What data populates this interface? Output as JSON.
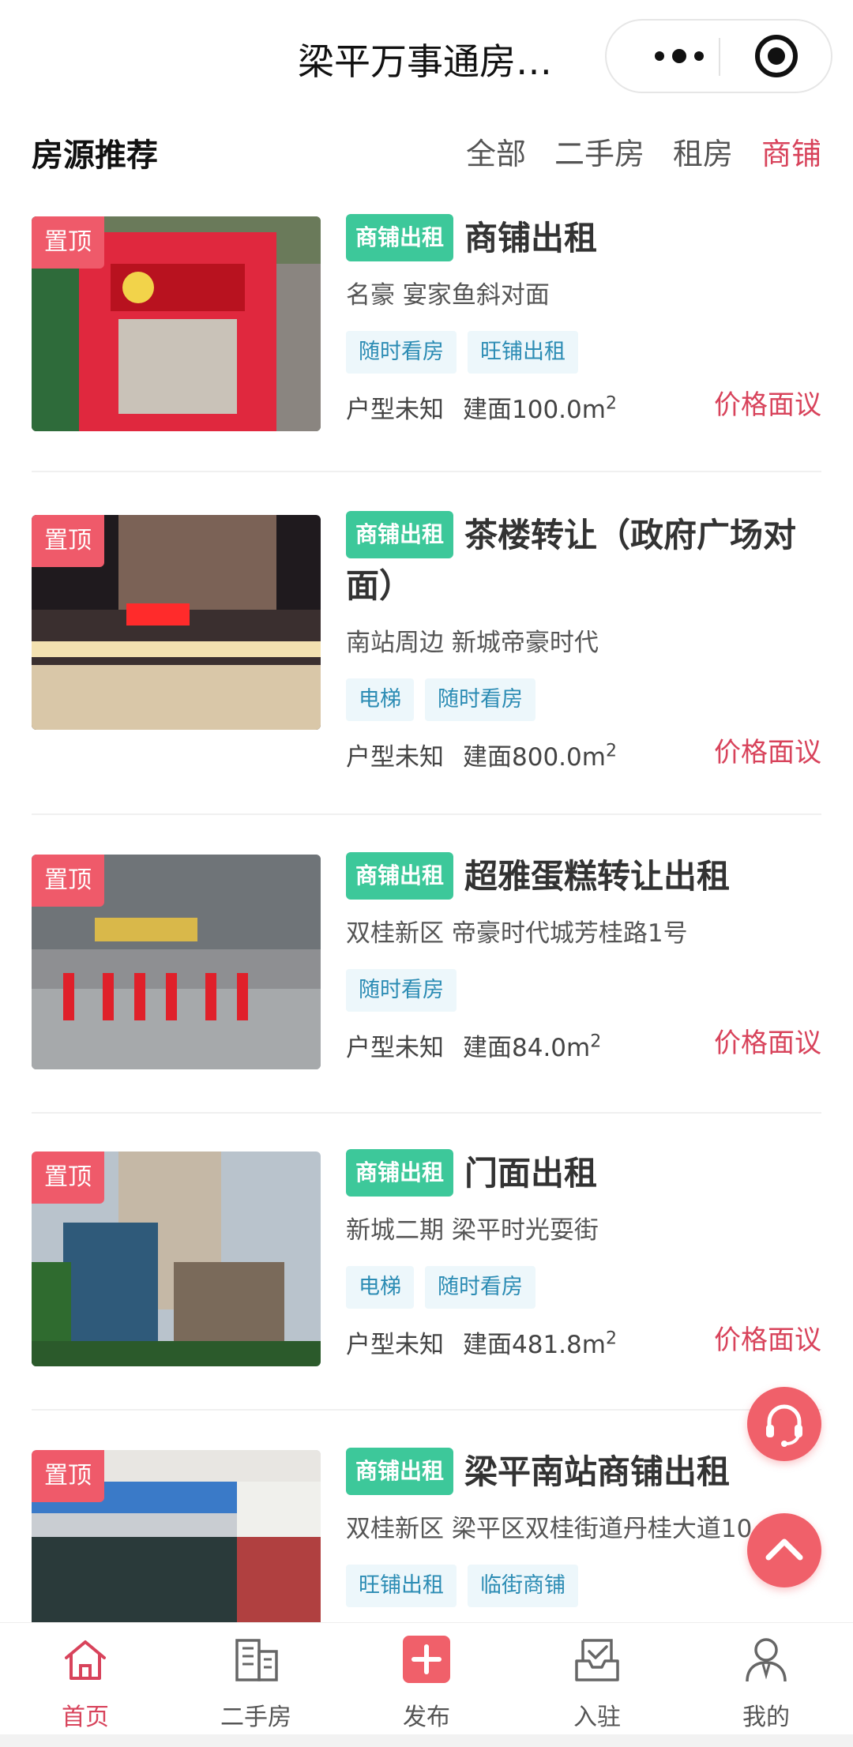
{
  "navbar": {
    "title": "梁平万事通房…",
    "more_icon": "more-dots-icon",
    "close_icon": "target-close-icon"
  },
  "section": {
    "title": "房源推荐",
    "filters": [
      {
        "label": "全部",
        "active": false
      },
      {
        "label": "二手房",
        "active": false
      },
      {
        "label": "租房",
        "active": false
      },
      {
        "label": "商铺",
        "active": true
      }
    ]
  },
  "listings": [
    {
      "pin": "置顶",
      "kind": "商铺出租",
      "title": "商铺出租",
      "address": "名豪 宴家鱼斜对面",
      "tags": [
        "随时看房",
        "旺铺出租"
      ],
      "layout": "户型未知",
      "area": "建面100.0m",
      "area_unit_sup": "2",
      "price": "价格面议"
    },
    {
      "pin": "置顶",
      "kind": "商铺出租",
      "title": "茶楼转让（政府广场对面）",
      "address": "南站周边 新城帝豪时代",
      "tags": [
        "电梯",
        "随时看房"
      ],
      "layout": "户型未知",
      "area": "建面800.0m",
      "area_unit_sup": "2",
      "price": "价格面议"
    },
    {
      "pin": "置顶",
      "kind": "商铺出租",
      "title": "超雅蛋糕转让出租",
      "address": "双桂新区 帝豪时代城芳桂路1号",
      "tags": [
        "随时看房"
      ],
      "layout": "户型未知",
      "area": "建面84.0m",
      "area_unit_sup": "2",
      "price": "价格面议"
    },
    {
      "pin": "置顶",
      "kind": "商铺出租",
      "title": "门面出租",
      "address": "新城二期 梁平时光耍街",
      "tags": [
        "电梯",
        "随时看房"
      ],
      "layout": "户型未知",
      "area": "建面481.8m",
      "area_unit_sup": "2",
      "price": "价格面议"
    },
    {
      "pin": "置顶",
      "kind": "商铺出租",
      "title": "梁平南站商铺出租",
      "address": "双桂新区 梁平区双桂街道丹桂大道10",
      "tags": [
        "旺铺出租",
        "临街商铺"
      ]
    }
  ],
  "fabs": {
    "service_icon": "headset-icon",
    "top_icon": "chevron-up-icon"
  },
  "tabbar": [
    {
      "label": "首页",
      "icon": "home-icon",
      "active": true
    },
    {
      "label": "二手房",
      "icon": "building-icon",
      "active": false
    },
    {
      "label": "发布",
      "icon": "plus-icon",
      "active": false
    },
    {
      "label": "入驻",
      "icon": "inbox-check-icon",
      "active": false
    },
    {
      "label": "我的",
      "icon": "user-icon",
      "active": false
    }
  ],
  "colors": {
    "accent": "#d8435b",
    "badge_green": "#3dc89a",
    "pin_red": "#ef5a6a",
    "tag_blue": "#2c8cb4"
  }
}
